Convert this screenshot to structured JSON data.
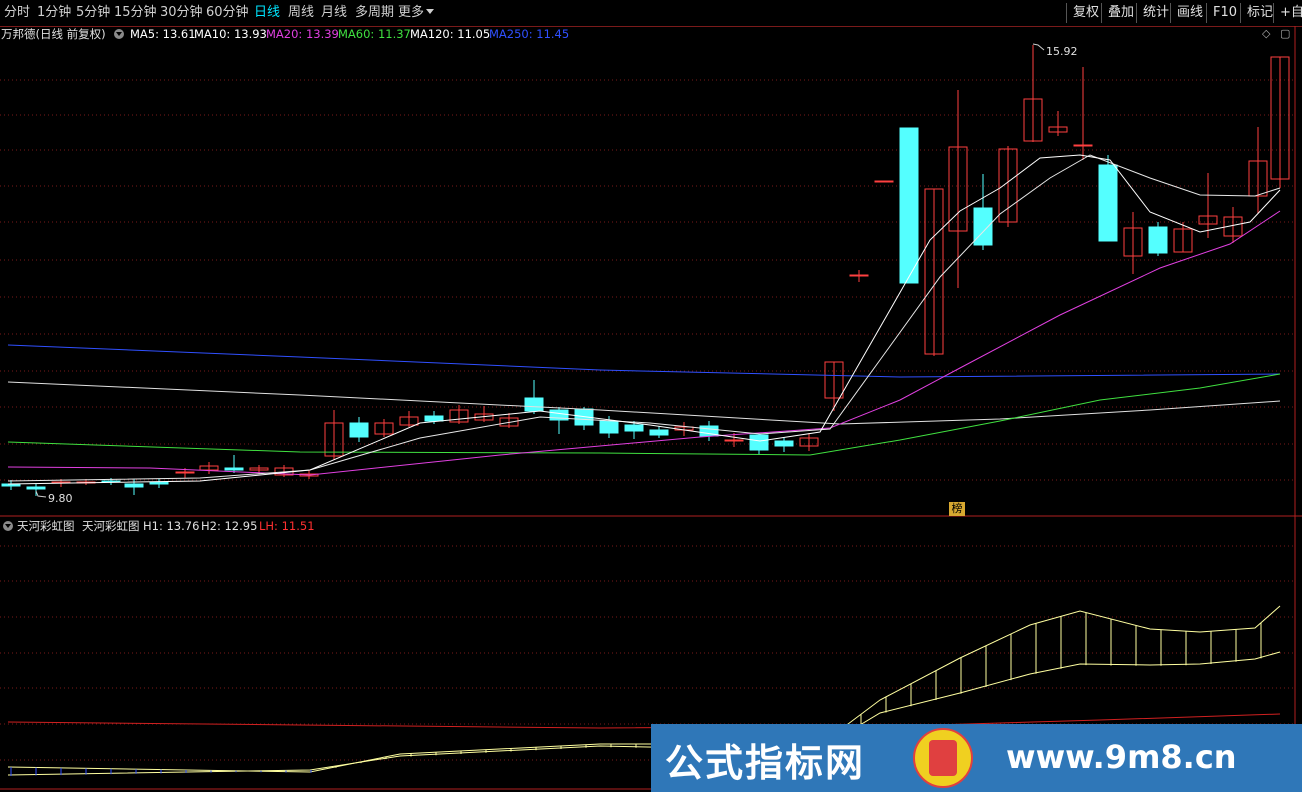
{
  "toolbar": {
    "periods": [
      "分时",
      "1分钟",
      "5分钟",
      "15分钟",
      "30分钟",
      "60分钟",
      "日线",
      "周线",
      "月线",
      "多周期",
      "更多"
    ],
    "active_period": "日线",
    "right_buttons": [
      "复权",
      "叠加",
      "统计",
      "画线",
      "F10",
      "标记",
      "+自选"
    ]
  },
  "legend": {
    "stock": "万邦德(日线 前复权)",
    "ma": [
      {
        "label": "MA5: 13.61",
        "color": "#ffffff"
      },
      {
        "label": "MA10: 13.93",
        "color": "#ffffff"
      },
      {
        "label": "MA20: 13.39",
        "color": "#e040e0"
      },
      {
        "label": "MA60: 11.37",
        "color": "#40e040"
      },
      {
        "label": "MA120: 11.05",
        "color": "#ffffff"
      },
      {
        "label": "MA250: 11.45",
        "color": "#3050ff"
      }
    ]
  },
  "price_labels": {
    "high": "15.92",
    "low": "9.80"
  },
  "stamp": "榜",
  "sub_indicator": {
    "name": "天河彩虹图",
    "title": "天河彩虹图",
    "h1": "H1: 13.76",
    "h2": "H2: 12.95",
    "lh": "LH: 11.51",
    "lh_color": "#ff3030"
  },
  "watermark": {
    "left": "公式指标网",
    "right": "www.9m8.cn"
  },
  "colors": {
    "up": "#ff4040",
    "down": "#54ffff",
    "grid": "#7a1a1a",
    "bg": "#000000"
  }
}
